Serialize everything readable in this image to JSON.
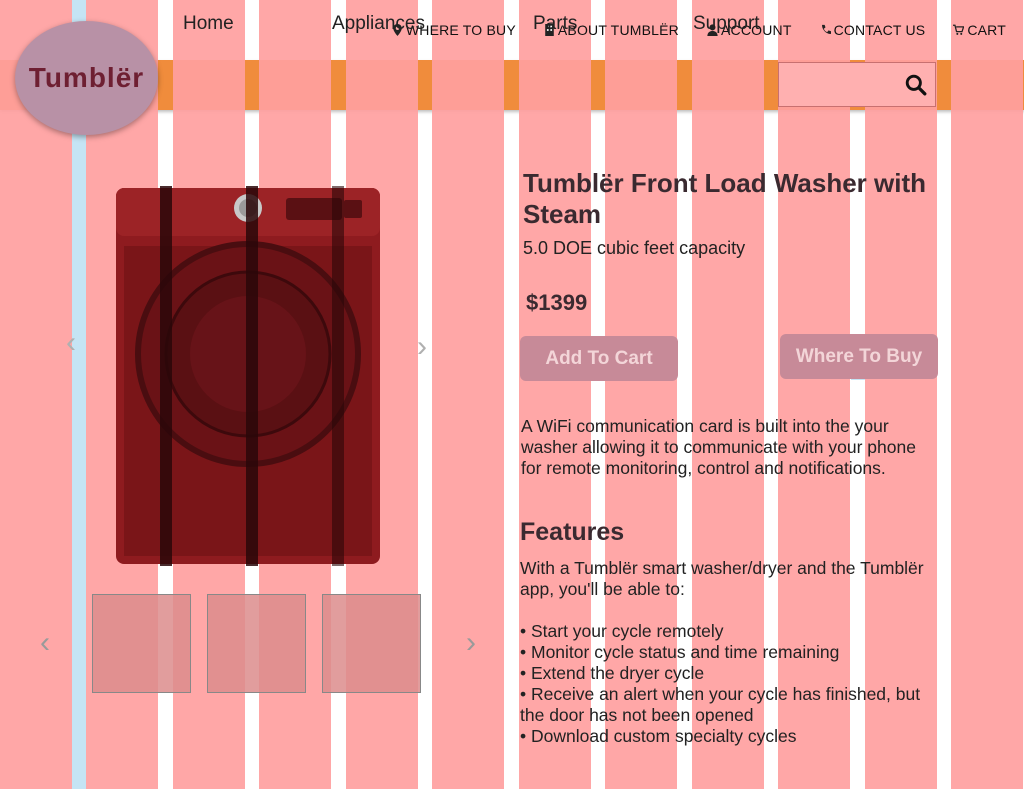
{
  "utility_nav": {
    "where_to_buy": "WHERE TO BUY",
    "about": "ABOUT TUMBLËR",
    "account": "ACCOUNT",
    "contact": "CONTACT US",
    "cart": "CART"
  },
  "logo": {
    "text": "Tumblër"
  },
  "main_nav": [
    "Home",
    "Appliances",
    "Parts",
    "Support"
  ],
  "search": {
    "placeholder": ""
  },
  "product": {
    "title": "Tumblër Front Load Washer with Steam",
    "capacity": "5.0 DOE cubic feet capacity",
    "price": "$1399",
    "add_to_cart_label": "Add To Cart",
    "where_to_buy_label": "Where To Buy",
    "description": "A WiFi communication card is built into the your washer allowing it to communicate with your phone for remote monitoring, control and notifications.",
    "features_heading": "Features",
    "features_intro": "With a Tumblër smart washer/dryer and the Tumblër app, you'll be able to:",
    "features": [
      "• Start your cycle remotely",
      "• Monitor cycle status and time remaining",
      "• Extend the dryer cycle",
      "• Receive an alert when your cycle has finished, but the door has not been opened",
      "• Download custom specialty cycles"
    ]
  },
  "colors": {
    "nav_bg": "#f08c3c",
    "overlay_pink": "#ffa0a0",
    "button_bg": "#c78a98",
    "heading": "#3a2a30"
  }
}
